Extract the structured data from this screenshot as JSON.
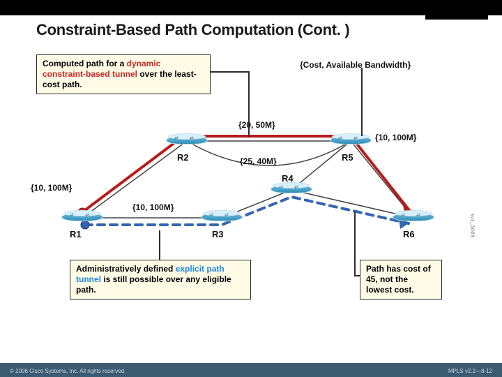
{
  "slide": {
    "title": "Constraint-Based Path Computation (Cont. )",
    "legend_header": "{Cost, Available Bandwidth}",
    "version_label": "sv1_5069"
  },
  "callout_dynamic": {
    "pre": "Computed path for a ",
    "em": "dynamic constraint-based tunnel",
    "post": " over the least-cost path."
  },
  "callout_explicit": {
    "pre": "Administratively defined ",
    "em": "explicit path tunnel",
    "post": " is still possible over any eligible path."
  },
  "callout_cost": {
    "text": "Path has cost of 45, not the lowest cost."
  },
  "routers": {
    "r1": "R1",
    "r2": "R2",
    "r3": "R3",
    "r4": "R4",
    "r5": "R5",
    "r6": "R6"
  },
  "links": {
    "r1_r2": "{10, 100M}",
    "r1_r3": "{10, 100M}",
    "r2_r5_top": "{20, 50M}",
    "r2_r5_mid": "{25, 40M}",
    "r5_r6": "{10, 100M}"
  },
  "footer": {
    "copyright": "© 2006 Cisco Systems, Inc. All rights reserved.",
    "pageref": "MPLS v2.2—8-12"
  },
  "chart_data": {
    "type": "table",
    "nodes": [
      "R1",
      "R2",
      "R3",
      "R4",
      "R5",
      "R6"
    ],
    "edges": [
      {
        "from": "R1",
        "to": "R2",
        "cost": 10,
        "bandwidth": "100M"
      },
      {
        "from": "R1",
        "to": "R3",
        "cost": 10,
        "bandwidth": "100M"
      },
      {
        "from": "R2",
        "to": "R5",
        "cost": 20,
        "bandwidth": "50M",
        "note": "upper"
      },
      {
        "from": "R2",
        "to": "R5",
        "cost": 25,
        "bandwidth": "40M",
        "note": "lower via R4 vicinity"
      },
      {
        "from": "R3",
        "to": "R4"
      },
      {
        "from": "R4",
        "to": "R5"
      },
      {
        "from": "R4",
        "to": "R6"
      },
      {
        "from": "R5",
        "to": "R6",
        "cost": 10,
        "bandwidth": "100M"
      }
    ],
    "dynamic_tunnel_path": [
      "R1",
      "R2",
      "R5",
      "R6"
    ],
    "explicit_tunnel_path": [
      "R1",
      "R3",
      "R4",
      "R6"
    ],
    "explicit_tunnel_cost": 45
  }
}
